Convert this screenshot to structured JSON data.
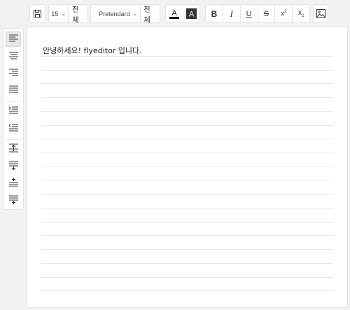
{
  "toolbar": {
    "font_size": "15",
    "font_size_all": "전체",
    "font_family": "Pretendard",
    "font_family_all": "전체",
    "icons": [
      "save-icon",
      "text-color-icon",
      "background-color-icon",
      "bold-icon",
      "italic-icon",
      "underline-icon",
      "strikethrough-icon",
      "superscript-icon",
      "subscript-icon",
      "image-icon"
    ],
    "colors": {
      "text_color": "#000000",
      "background_color": "#333333"
    }
  },
  "sidebar": {
    "items": [
      "align-left",
      "align-center",
      "align-right",
      "align-justify",
      "indent",
      "outdent",
      "line-height-up",
      "line-height-down",
      "spacing-increase",
      "spacing-decrease"
    ],
    "active": "align-left"
  },
  "editor": {
    "lines": [
      "안녕하세요! flyeditor 입니다."
    ]
  }
}
